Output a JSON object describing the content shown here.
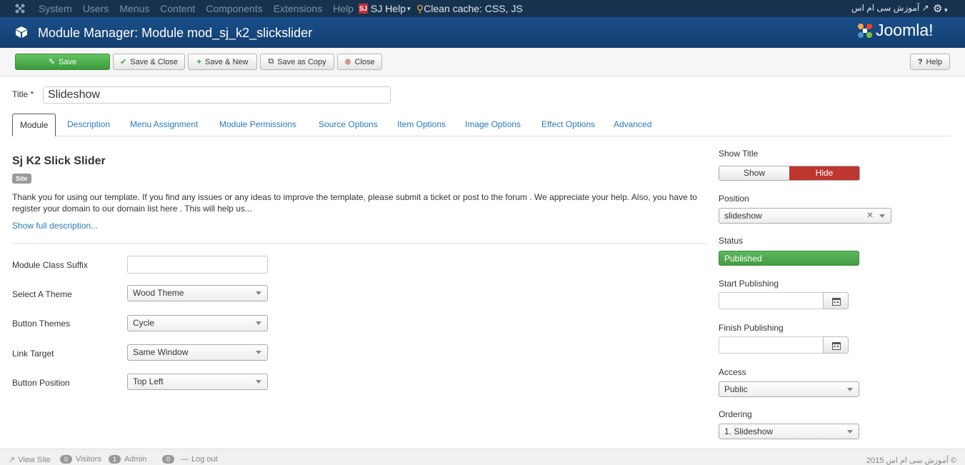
{
  "navbar": {
    "menu": [
      "System",
      "Users",
      "Menus",
      "Content",
      "Components",
      "Extensions",
      "Help"
    ],
    "sj_help": "SJ Help",
    "clean_cache": "Clean cache: CSS, JS",
    "site_link": "آموزش سی ام اس"
  },
  "header": {
    "title": "Module Manager: Module mod_sj_k2_slickslider",
    "brand": "Joomla!"
  },
  "toolbar": {
    "save": "Save",
    "save_close": "Save & Close",
    "save_new": "Save & New",
    "save_copy": "Save as Copy",
    "close": "Close",
    "help": "Help"
  },
  "form": {
    "title_label": "Title *",
    "title_value": "Slideshow"
  },
  "tabs": [
    "Module",
    "Description",
    "Menu Assignment",
    "Module Permissions",
    "Source Options",
    "Item Options",
    "Image Options",
    "Effect Options",
    "Advanced"
  ],
  "module": {
    "name": "Sj K2 Slick Slider",
    "badge": "Site",
    "description": "Thank you for using our template. If you find any issues or any ideas to improve the template, please submit a ticket or post to the forum . We appreciate your help. Also, you have to register your domain to our domain list here . This will help us...",
    "show_full": "Show full description..."
  },
  "fields": {
    "class_suffix_label": "Module Class Suffix",
    "class_suffix_value": "",
    "theme_label": "Select A Theme",
    "theme_value": "Wood Theme",
    "button_themes_label": "Button Themes",
    "button_themes_value": "Cycle",
    "link_target_label": "Link Target",
    "link_target_value": "Same Window",
    "button_position_label": "Button Position",
    "button_position_value": "Top Left"
  },
  "sidebar": {
    "show_title_label": "Show Title",
    "show_label": "Show",
    "hide_label": "Hide",
    "position_label": "Position",
    "position_value": "slideshow",
    "status_label": "Status",
    "status_value": "Published",
    "start_label": "Start Publishing",
    "finish_label": "Finish Publishing",
    "access_label": "Access",
    "access_value": "Public",
    "ordering_label": "Ordering",
    "ordering_value": "1. Slideshow"
  },
  "footer": {
    "view_site": "View Site",
    "visitors_count": "0",
    "visitors": "Visitors",
    "admin_count": "1",
    "admin": "Admin",
    "messages_count": "0",
    "logout": "Log out",
    "copyright": "آموزش سی ام اس 2015 ©"
  },
  "colors": {
    "navbar": "#17324f",
    "header": "#1a4f8a",
    "save_button": "#51a351",
    "hide_active": "#bd362f",
    "status_published": "#5cb85c",
    "link": "#2a7ab9"
  }
}
